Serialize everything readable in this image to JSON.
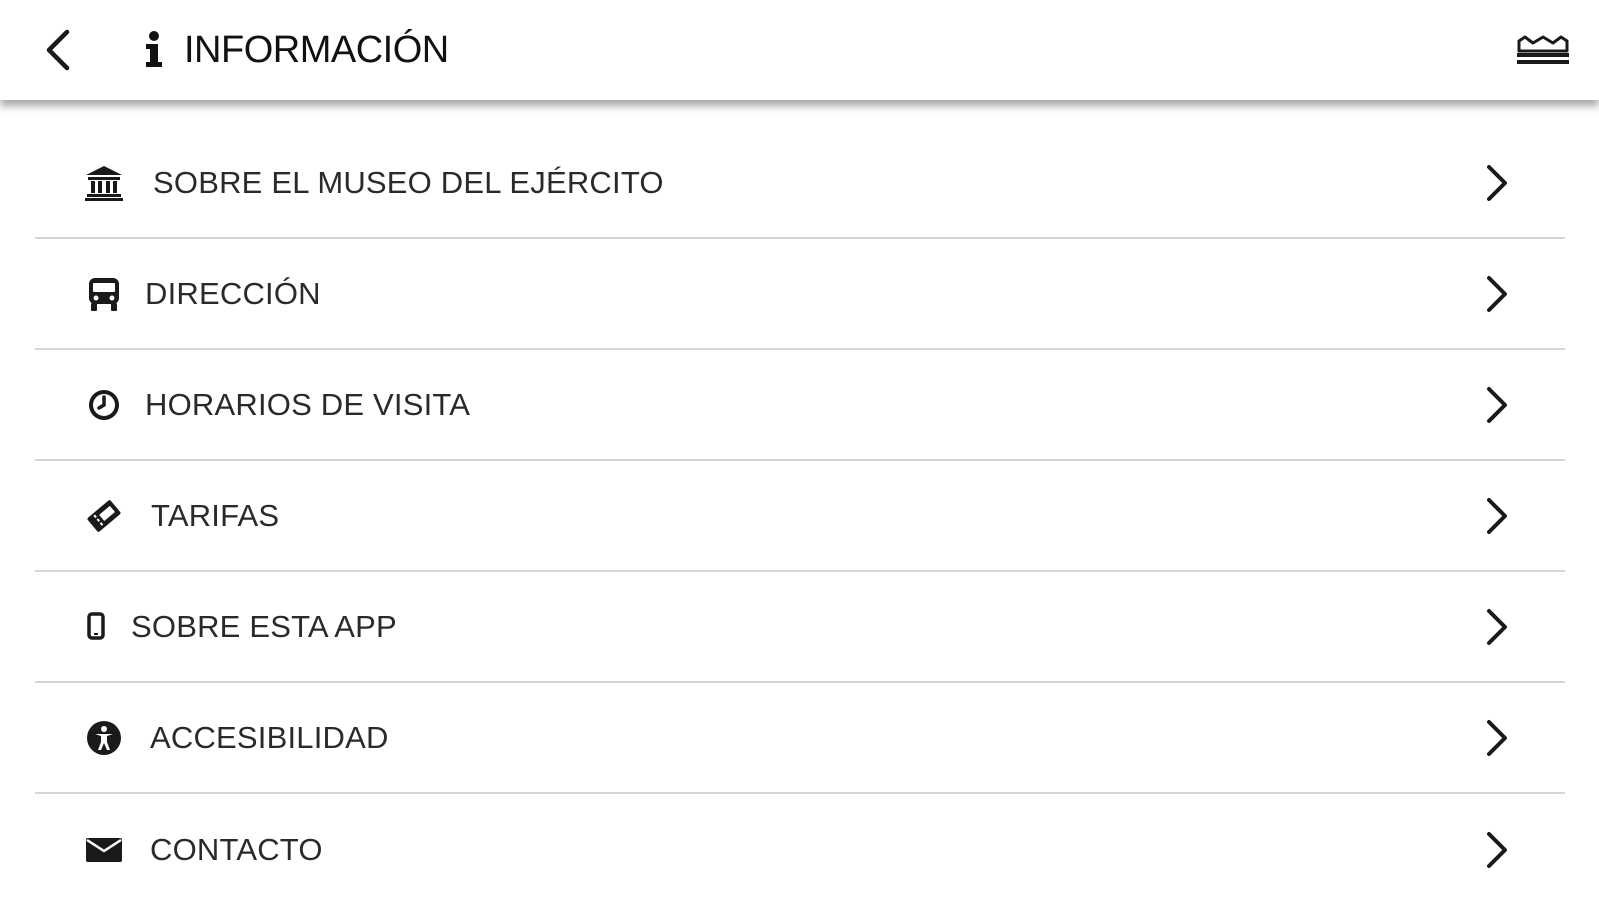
{
  "header": {
    "title": "INFORMACIÓN",
    "back_icon": "chevron-left-icon",
    "info_icon": "info-icon",
    "menu_icon": "sofa-icon"
  },
  "menu": {
    "items": [
      {
        "label": "SOBRE EL MUSEO DEL EJÉRCITO",
        "icon": "museum-icon"
      },
      {
        "label": "DIRECCIÓN",
        "icon": "bus-icon"
      },
      {
        "label": "HORARIOS DE VISITA",
        "icon": "clock-icon"
      },
      {
        "label": "TARIFAS",
        "icon": "ticket-icon"
      },
      {
        "label": "SOBRE ESTA APP",
        "icon": "mobile-icon"
      },
      {
        "label": "ACCESIBILIDAD",
        "icon": "accessibility-icon"
      },
      {
        "label": "CONTACTO",
        "icon": "envelope-icon"
      }
    ]
  },
  "colors": {
    "text": "#1e1e1e",
    "divider": "#d6d6d6",
    "background": "#ffffff"
  }
}
